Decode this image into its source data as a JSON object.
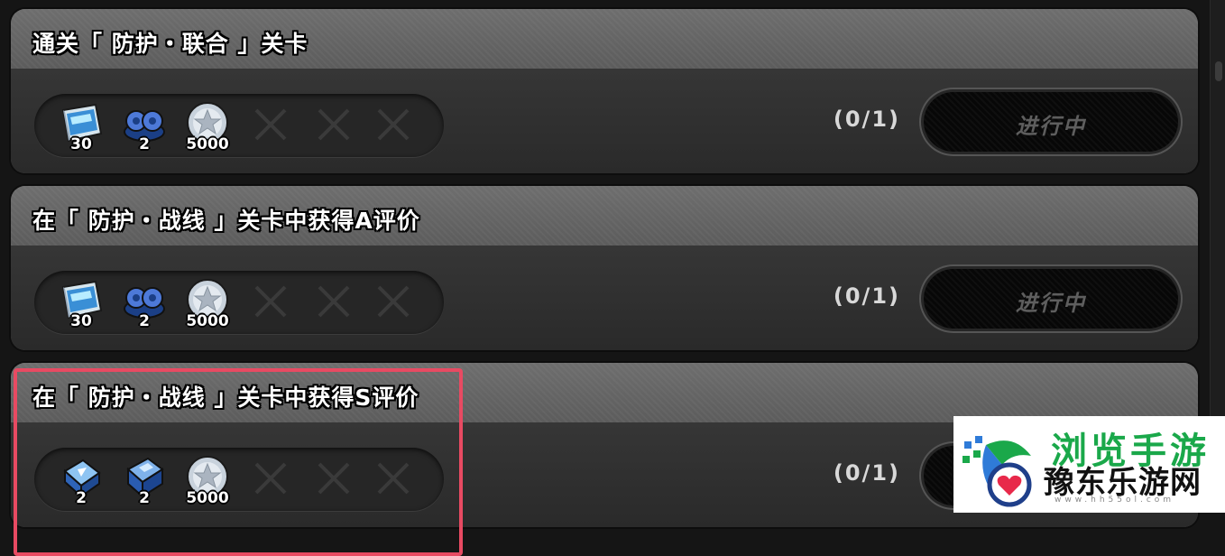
{
  "missions": [
    {
      "title": "通关「 防护・联合 」关卡",
      "rewards": [
        {
          "icon": "blue-ticket-card-icon",
          "qty": "30"
        },
        {
          "icon": "blue-gear-cogs-icon",
          "qty": "2"
        },
        {
          "icon": "silver-star-coin-icon",
          "qty": "5000"
        }
      ],
      "progress": "(0/1)",
      "status": "进行中"
    },
    {
      "title": "在「 防护・战线 」关卡中获得A评价",
      "rewards": [
        {
          "icon": "blue-ticket-card-icon",
          "qty": "30"
        },
        {
          "icon": "blue-gear-cogs-icon",
          "qty": "2"
        },
        {
          "icon": "silver-star-coin-icon",
          "qty": "5000"
        }
      ],
      "progress": "(0/1)",
      "status": "进行中"
    },
    {
      "title": "在「 防护・战线 」关卡中获得S评价",
      "rewards": [
        {
          "icon": "blue-crystal-chip-icon",
          "qty": "2"
        },
        {
          "icon": "blue-data-disk-icon",
          "qty": "2"
        },
        {
          "icon": "silver-star-coin-icon",
          "qty": "5000"
        }
      ],
      "progress": "(0/1)",
      "status": ""
    }
  ],
  "watermark": {
    "brand": "浏览手游",
    "site": "豫东乐游网",
    "url": "www.hh55ol.com"
  },
  "colors": {
    "highlight": "#e84a62",
    "header": "#626262",
    "body": "#303030",
    "watermark_green": "#1aa84a"
  }
}
